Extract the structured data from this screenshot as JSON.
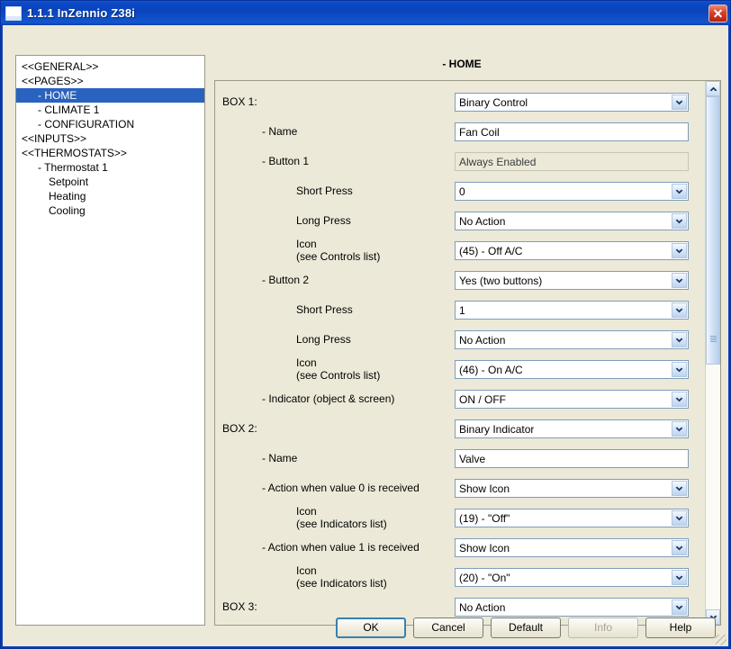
{
  "window": {
    "title": "1.1.1 InZennio Z38i",
    "close_label": "Close",
    "app_icon": "window-icon"
  },
  "tree": {
    "items": [
      {
        "label": "<<GENERAL>>",
        "level": 1,
        "selected": false
      },
      {
        "label": "<<PAGES>>",
        "level": 1,
        "selected": false
      },
      {
        "label": "- HOME",
        "level": 2,
        "selected": true
      },
      {
        "label": "- CLIMATE 1",
        "level": 2,
        "selected": false
      },
      {
        "label": "- CONFIGURATION",
        "level": 2,
        "selected": false
      },
      {
        "label": "<<INPUTS>>",
        "level": 1,
        "selected": false
      },
      {
        "label": "<<THERMOSTATS>>",
        "level": 1,
        "selected": false
      },
      {
        "label": "- Thermostat 1",
        "level": 2,
        "selected": false
      },
      {
        "label": "Setpoint",
        "level": 3,
        "selected": false
      },
      {
        "label": "Heating",
        "level": 3,
        "selected": false
      },
      {
        "label": "Cooling",
        "level": 3,
        "selected": false
      }
    ]
  },
  "header": {
    "title": "- HOME"
  },
  "form": {
    "rows": [
      {
        "label": "BOX 1:",
        "sublabel": "",
        "indent": 0,
        "control": "combo",
        "value": "Binary Control"
      },
      {
        "label": "- Name",
        "sublabel": "",
        "indent": 1,
        "control": "text",
        "value": "Fan Coil"
      },
      {
        "label": "- Button 1",
        "sublabel": "",
        "indent": 1,
        "control": "readonly",
        "value": "Always Enabled"
      },
      {
        "label": "Short Press",
        "sublabel": "",
        "indent": 2,
        "control": "combo",
        "value": "0"
      },
      {
        "label": "Long Press",
        "sublabel": "",
        "indent": 2,
        "control": "combo",
        "value": "No Action"
      },
      {
        "label": "Icon",
        "sublabel": "(see Controls list)",
        "indent": 2,
        "control": "combo",
        "value": "(45) - Off A/C"
      },
      {
        "label": "- Button 2",
        "sublabel": "",
        "indent": 1,
        "control": "combo",
        "value": "Yes (two buttons)"
      },
      {
        "label": "Short Press",
        "sublabel": "",
        "indent": 2,
        "control": "combo",
        "value": "1"
      },
      {
        "label": "Long Press",
        "sublabel": "",
        "indent": 2,
        "control": "combo",
        "value": "No Action"
      },
      {
        "label": "Icon",
        "sublabel": "(see Controls list)",
        "indent": 2,
        "control": "combo",
        "value": "(46) - On A/C"
      },
      {
        "label": "- Indicator (object & screen)",
        "sublabel": "",
        "indent": 1,
        "control": "combo",
        "value": "ON / OFF"
      },
      {
        "label": "BOX 2:",
        "sublabel": "",
        "indent": 0,
        "control": "combo",
        "value": "Binary Indicator"
      },
      {
        "label": "- Name",
        "sublabel": "",
        "indent": 1,
        "control": "text",
        "value": "Valve"
      },
      {
        "label": "- Action when value 0 is received",
        "sublabel": "",
        "indent": 1,
        "control": "combo",
        "value": "Show Icon"
      },
      {
        "label": "Icon",
        "sublabel": "(see Indicators list)",
        "indent": 2,
        "control": "combo",
        "value": "(19) - \"Off\""
      },
      {
        "label": "- Action when value 1 is received",
        "sublabel": "",
        "indent": 1,
        "control": "combo",
        "value": "Show Icon"
      },
      {
        "label": "Icon",
        "sublabel": "(see Indicators list)",
        "indent": 2,
        "control": "combo",
        "value": "(20) - \"On\""
      },
      {
        "label": "BOX 3:",
        "sublabel": "",
        "indent": 0,
        "control": "combo",
        "value": "No Action"
      }
    ]
  },
  "scrollbar": {
    "up_icon": "chevron-up-icon",
    "down_icon": "chevron-down-icon"
  },
  "buttons": [
    {
      "label": "OK",
      "style": "default"
    },
    {
      "label": "Cancel",
      "style": "normal"
    },
    {
      "label": "Default",
      "style": "normal"
    },
    {
      "label": "Info",
      "style": "disabled"
    },
    {
      "label": "Help",
      "style": "normal"
    }
  ]
}
